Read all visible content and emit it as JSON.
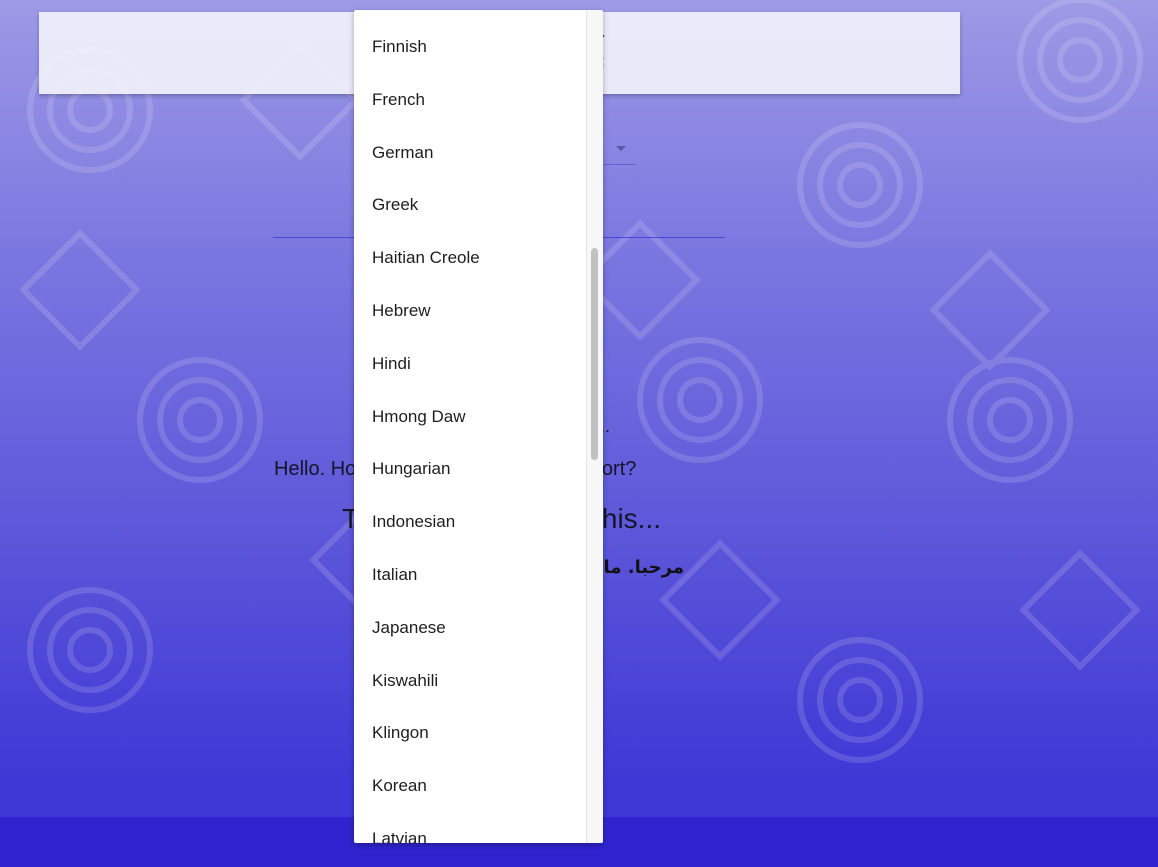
{
  "top_card": {
    "chevrons": "›\n‹"
  },
  "translator": {
    "ellipsis": "..",
    "source_text": "Hello. How far is it to the nearest airport?",
    "result_heading": "This is how you say this...",
    "translated_text": "مرحبا. ما مدى بعد أقرب مطار؟"
  },
  "language_dropdown": {
    "items": [
      "Finnish",
      "French",
      "German",
      "Greek",
      "Haitian Creole",
      "Hebrew",
      "Hindi",
      "Hmong Daw",
      "Hungarian",
      "Indonesian",
      "Italian",
      "Japanese",
      "Kiswahili",
      "Klingon",
      "Korean",
      "Latvian"
    ],
    "scroll_fraction": 0.29
  },
  "colors": {
    "background_top": "#9d9ae6",
    "background_bottom": "#3f38d6",
    "footer": "#3024d0",
    "underline": "#4a44d8"
  }
}
